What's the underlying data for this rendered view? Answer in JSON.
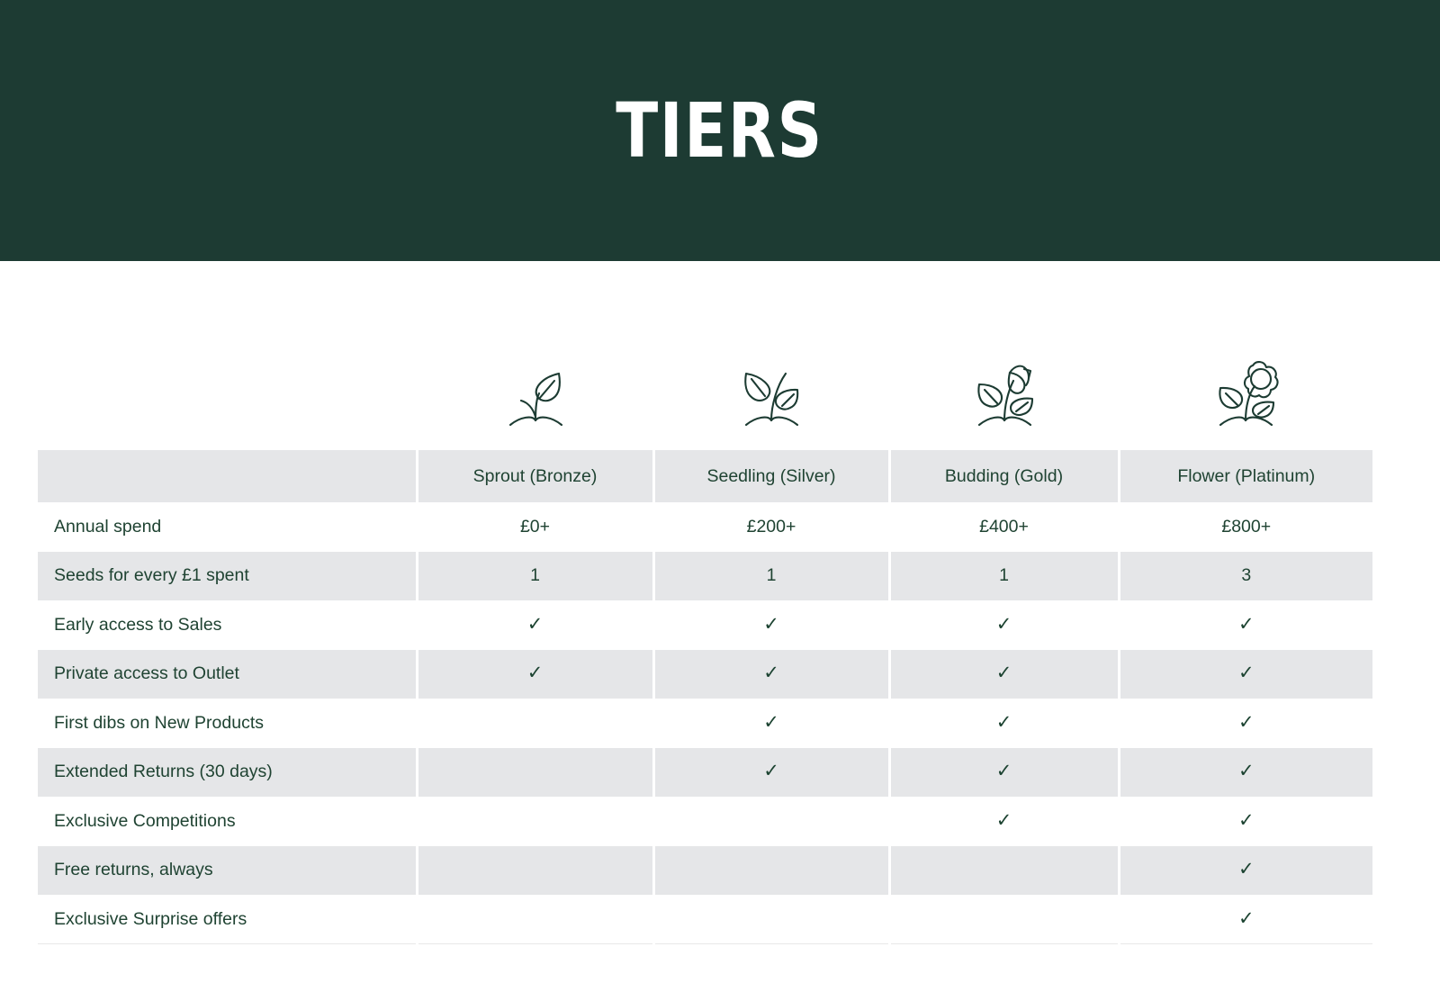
{
  "hero": {
    "title": "TIERS",
    "background_color": "#1d3b33",
    "text_color": "#ffffff"
  },
  "theme": {
    "text_green": "#1f4332",
    "row_shade": "#e5e6e8",
    "row_plain": "#ffffff",
    "divider": "#ffffff",
    "bottom_border": "#e8e8e8"
  },
  "table": {
    "corner_label": "",
    "columns": [
      {
        "key": "sprout",
        "label": "Sprout (Bronze)",
        "icon": "sprout-single-leaf-icon"
      },
      {
        "key": "seedling",
        "label": "Seedling (Silver)",
        "icon": "seedling-two-leaves-icon"
      },
      {
        "key": "budding",
        "label": "Budding (Gold)",
        "icon": "budding-rose-icon"
      },
      {
        "key": "flower",
        "label": "Flower (Platinum)",
        "icon": "flower-bloom-icon"
      }
    ],
    "rows": [
      {
        "label": "Annual spend",
        "values": [
          "£0+",
          "£200+",
          "£400+",
          "£800+"
        ]
      },
      {
        "label": "Seeds for every £1 spent",
        "values": [
          "1",
          "1",
          "1",
          "3"
        ]
      },
      {
        "label": "Early access to Sales",
        "values": [
          "✓",
          "✓",
          "✓",
          "✓"
        ]
      },
      {
        "label": "Private access to Outlet",
        "values": [
          "✓",
          "✓",
          "✓",
          "✓"
        ]
      },
      {
        "label": "First dibs on New Products",
        "values": [
          "",
          "✓",
          "✓",
          "✓"
        ]
      },
      {
        "label": "Extended Returns (30 days)",
        "values": [
          "",
          "✓",
          "✓",
          "✓"
        ]
      },
      {
        "label": "Exclusive Competitions",
        "values": [
          "",
          "",
          "✓",
          "✓"
        ]
      },
      {
        "label": "Free returns, always",
        "values": [
          "",
          "",
          "",
          "✓"
        ]
      },
      {
        "label": "Exclusive Surprise offers",
        "values": [
          "",
          "",
          "",
          "✓"
        ]
      }
    ]
  }
}
